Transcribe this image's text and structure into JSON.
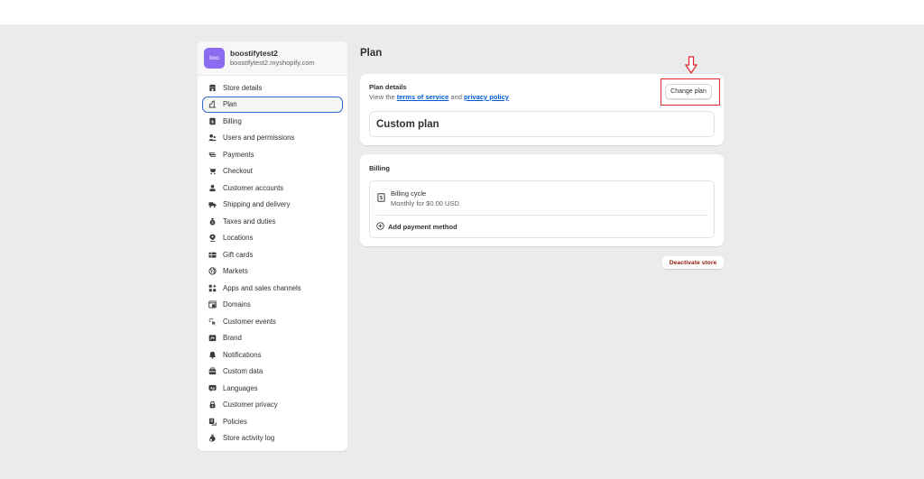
{
  "store": {
    "avatar_text": "boo",
    "avatar_color": "#8b6cf0",
    "name": "boostifytest2",
    "url": "boostifytest2.myshopify.com"
  },
  "sidebar": {
    "items": [
      {
        "label": "Store details",
        "icon": "store-icon",
        "active": false
      },
      {
        "label": "Plan",
        "icon": "plan-icon",
        "active": true
      },
      {
        "label": "Billing",
        "icon": "billing-icon",
        "active": false
      },
      {
        "label": "Users and permissions",
        "icon": "users-icon",
        "active": false
      },
      {
        "label": "Payments",
        "icon": "payments-icon",
        "active": false
      },
      {
        "label": "Checkout",
        "icon": "cart-icon",
        "active": false
      },
      {
        "label": "Customer accounts",
        "icon": "person-icon",
        "active": false
      },
      {
        "label": "Shipping and delivery",
        "icon": "truck-icon",
        "active": false
      },
      {
        "label": "Taxes and duties",
        "icon": "money-bag-icon",
        "active": false
      },
      {
        "label": "Locations",
        "icon": "location-pin-icon",
        "active": false
      },
      {
        "label": "Gift cards",
        "icon": "gift-card-icon",
        "active": false
      },
      {
        "label": "Markets",
        "icon": "globe-icon",
        "active": false
      },
      {
        "label": "Apps and sales channels",
        "icon": "apps-icon",
        "active": false
      },
      {
        "label": "Domains",
        "icon": "domain-icon",
        "active": false
      },
      {
        "label": "Customer events",
        "icon": "cursor-click-icon",
        "active": false
      },
      {
        "label": "Brand",
        "icon": "brand-icon",
        "active": false
      },
      {
        "label": "Notifications",
        "icon": "bell-icon",
        "active": false
      },
      {
        "label": "Custom data",
        "icon": "database-icon",
        "active": false
      },
      {
        "label": "Languages",
        "icon": "language-icon",
        "active": false
      },
      {
        "label": "Customer privacy",
        "icon": "lock-icon",
        "active": false
      },
      {
        "label": "Policies",
        "icon": "policies-icon",
        "active": false
      },
      {
        "label": "Store activity log",
        "icon": "activity-log-icon",
        "active": false
      }
    ]
  },
  "main": {
    "title": "Plan",
    "plan_card": {
      "title": "Plan details",
      "sub_prefix": "View the ",
      "terms_link": "terms of service",
      "sub_and": " and ",
      "privacy_link": "privacy policy",
      "change_button": "Change plan",
      "plan_name": "Custom plan"
    },
    "billing_card": {
      "title": "Billing",
      "cycle_title": "Billing cycle",
      "cycle_value": "Monthly for $0.00 USD",
      "add_payment": "Add payment method"
    },
    "deactivate_button": "Deactivate store"
  },
  "annotations": {
    "highlight_color": "#e0262c",
    "target": "Change plan"
  }
}
